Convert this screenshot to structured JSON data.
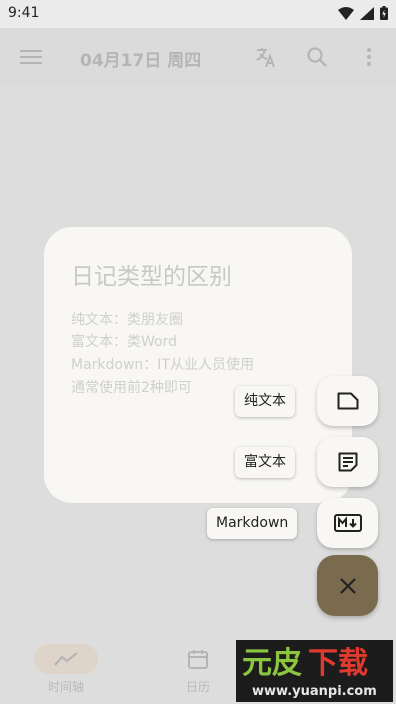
{
  "status_bar": {
    "time": "9:41"
  },
  "app_bar": {
    "title": "04月17日 周四"
  },
  "dialog": {
    "title": "日记类型的区别",
    "lines": [
      "纯文本：类朋友圈",
      "富文本：类Word",
      "Markdown：IT从业人员使用",
      "通常使用前2种即可"
    ]
  },
  "fab_menu": {
    "items": [
      {
        "label": "纯文本",
        "icon": "plain-note-icon"
      },
      {
        "label": "富文本",
        "icon": "rich-note-icon"
      },
      {
        "label": "Markdown",
        "icon": "markdown-icon"
      }
    ],
    "close_icon": "close-icon"
  },
  "bottom_nav": {
    "items": [
      {
        "label": "时间轴",
        "icon": "timeline-icon"
      },
      {
        "label": "日历",
        "icon": "calendar-icon"
      }
    ]
  },
  "watermark": {
    "brand": "元皮下载",
    "url": "www.yuanpi.com"
  },
  "colors": {
    "fab": "#7a6a4e",
    "surface": "#f8f7f4",
    "scrim": "#e6e6e6"
  }
}
